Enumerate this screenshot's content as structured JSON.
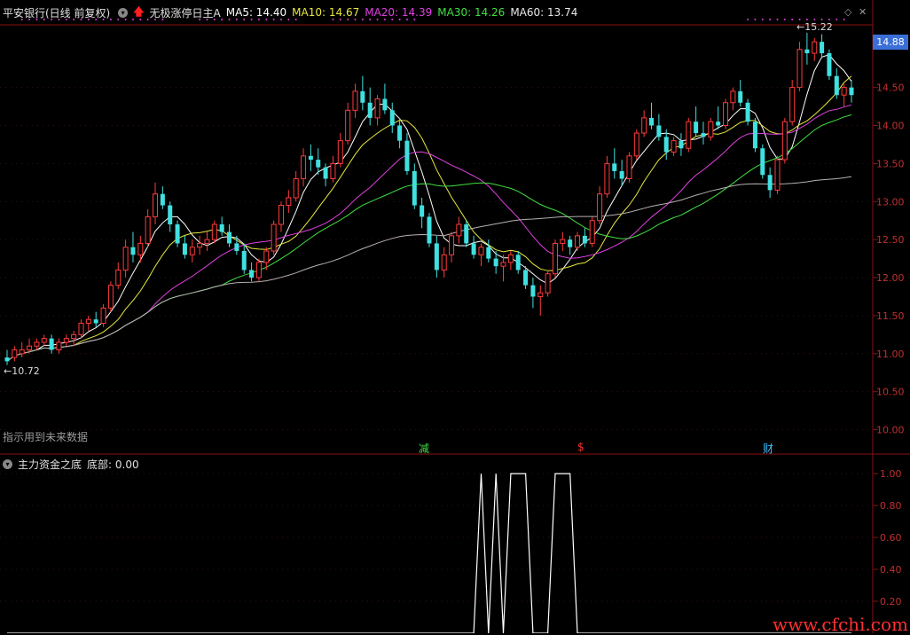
{
  "header": {
    "stock_title": "平安银行(日线 前复权)",
    "indicator_name": "无极涨停日主A",
    "ma5": {
      "label": "MA5: 14.40",
      "color": "#ffffff"
    },
    "ma10": {
      "label": "MA10: 14.67",
      "color": "#e8e840"
    },
    "ma20": {
      "label": "MA20: 14.39",
      "color": "#e040e0"
    },
    "ma30": {
      "label": "MA30: 14.26",
      "color": "#40e040"
    },
    "ma60": {
      "label": "MA60: 13.74",
      "color": "#e8e8e8"
    }
  },
  "price_axis": {
    "ticks": [
      "14.50",
      "14.00",
      "13.50",
      "13.00",
      "12.50",
      "12.00",
      "11.50",
      "11.00",
      "10.50",
      "10.00"
    ],
    "min": 9.75,
    "max": 15.3
  },
  "current_price": "14.88",
  "high_label": "15.22",
  "low_label": "10.72",
  "warning_text": "指示用到未来数据",
  "markers": [
    {
      "text": "减",
      "color": "#40e040"
    },
    {
      "text": "$",
      "color": "#ff3030"
    },
    {
      "text": "财",
      "color": "#40c0ff"
    }
  ],
  "sub_header": {
    "indicator_name": "主力资金之底",
    "value_label": "底部: 0.00"
  },
  "sub_axis": {
    "ticks": [
      "1.00",
      "0.80",
      "0.60",
      "0.40",
      "0.20"
    ]
  },
  "watermark": "www.cfchi.com",
  "chart_data": {
    "type": "candlestick",
    "candles": [
      [
        10.95,
        11.05,
        10.85,
        10.9
      ],
      [
        10.95,
        11.1,
        10.9,
        11.05
      ],
      [
        11.0,
        11.15,
        10.95,
        11.05
      ],
      [
        11.05,
        11.2,
        11.0,
        11.1
      ],
      [
        11.1,
        11.2,
        11.05,
        11.15
      ],
      [
        11.15,
        11.25,
        11.1,
        11.2
      ],
      [
        11.2,
        11.25,
        11.0,
        11.05
      ],
      [
        11.05,
        11.2,
        11.0,
        11.15
      ],
      [
        11.15,
        11.25,
        11.1,
        11.2
      ],
      [
        11.2,
        11.3,
        11.1,
        11.25
      ],
      [
        11.25,
        11.45,
        11.2,
        11.4
      ],
      [
        11.4,
        11.5,
        11.3,
        11.45
      ],
      [
        11.45,
        11.55,
        11.35,
        11.4
      ],
      [
        11.4,
        11.65,
        11.35,
        11.6
      ],
      [
        11.6,
        11.95,
        11.55,
        11.9
      ],
      [
        11.9,
        12.2,
        11.85,
        12.1
      ],
      [
        12.1,
        12.5,
        12.0,
        12.4
      ],
      [
        12.4,
        12.6,
        12.2,
        12.3
      ],
      [
        12.3,
        12.55,
        12.2,
        12.45
      ],
      [
        12.45,
        12.9,
        12.4,
        12.8
      ],
      [
        12.8,
        13.25,
        12.7,
        13.1
      ],
      [
        13.1,
        13.2,
        12.9,
        12.95
      ],
      [
        12.95,
        13.0,
        12.6,
        12.7
      ],
      [
        12.7,
        12.75,
        12.4,
        12.45
      ],
      [
        12.45,
        12.55,
        12.25,
        12.3
      ],
      [
        12.3,
        12.5,
        12.2,
        12.4
      ],
      [
        12.4,
        12.55,
        12.3,
        12.45
      ],
      [
        12.45,
        12.6,
        12.35,
        12.5
      ],
      [
        12.5,
        12.75,
        12.45,
        12.7
      ],
      [
        12.7,
        12.8,
        12.55,
        12.6
      ],
      [
        12.6,
        12.7,
        12.4,
        12.45
      ],
      [
        12.45,
        12.55,
        12.3,
        12.35
      ],
      [
        12.35,
        12.45,
        12.05,
        12.1
      ],
      [
        12.1,
        12.2,
        11.95,
        12.0
      ],
      [
        12.0,
        12.25,
        11.95,
        12.2
      ],
      [
        12.2,
        12.4,
        12.1,
        12.35
      ],
      [
        12.35,
        12.75,
        12.3,
        12.7
      ],
      [
        12.7,
        13.0,
        12.6,
        12.95
      ],
      [
        12.95,
        13.15,
        12.85,
        13.05
      ],
      [
        13.05,
        13.4,
        13.0,
        13.3
      ],
      [
        13.3,
        13.7,
        13.2,
        13.6
      ],
      [
        13.6,
        13.75,
        13.4,
        13.55
      ],
      [
        13.55,
        13.7,
        13.35,
        13.45
      ],
      [
        13.45,
        13.5,
        13.2,
        13.3
      ],
      [
        13.3,
        13.6,
        13.25,
        13.5
      ],
      [
        13.5,
        13.9,
        13.45,
        13.8
      ],
      [
        13.8,
        14.3,
        13.75,
        14.2
      ],
      [
        14.2,
        14.55,
        14.1,
        14.45
      ],
      [
        14.45,
        14.65,
        14.2,
        14.3
      ],
      [
        14.3,
        14.5,
        14.0,
        14.1
      ],
      [
        14.1,
        14.4,
        14.0,
        14.35
      ],
      [
        14.35,
        14.55,
        14.15,
        14.2
      ],
      [
        14.2,
        14.3,
        13.9,
        14.0
      ],
      [
        14.0,
        14.1,
        13.7,
        13.8
      ],
      [
        13.8,
        13.9,
        13.35,
        13.4
      ],
      [
        13.4,
        13.5,
        12.9,
        12.95
      ],
      [
        12.95,
        13.05,
        12.65,
        12.8
      ],
      [
        12.8,
        12.85,
        12.4,
        12.45
      ],
      [
        12.45,
        12.55,
        12.0,
        12.1
      ],
      [
        12.1,
        12.4,
        12.0,
        12.3
      ],
      [
        12.3,
        12.6,
        12.2,
        12.55
      ],
      [
        12.55,
        12.8,
        12.45,
        12.7
      ],
      [
        12.7,
        12.75,
        12.4,
        12.45
      ],
      [
        12.45,
        12.55,
        12.25,
        12.3
      ],
      [
        12.3,
        12.45,
        12.15,
        12.4
      ],
      [
        12.4,
        12.5,
        12.2,
        12.25
      ],
      [
        12.25,
        12.35,
        12.05,
        12.15
      ],
      [
        12.15,
        12.3,
        11.95,
        12.2
      ],
      [
        12.2,
        12.35,
        12.1,
        12.3
      ],
      [
        12.3,
        12.35,
        12.05,
        12.1
      ],
      [
        12.1,
        12.15,
        11.85,
        11.9
      ],
      [
        11.9,
        12.0,
        11.6,
        11.75
      ],
      [
        11.75,
        11.9,
        11.5,
        11.8
      ],
      [
        11.8,
        12.1,
        11.75,
        12.05
      ],
      [
        12.05,
        12.5,
        12.0,
        12.45
      ],
      [
        12.45,
        12.6,
        12.35,
        12.5
      ],
      [
        12.5,
        12.55,
        12.3,
        12.4
      ],
      [
        12.4,
        12.6,
        12.35,
        12.55
      ],
      [
        12.55,
        12.65,
        12.4,
        12.45
      ],
      [
        12.45,
        12.8,
        12.4,
        12.75
      ],
      [
        12.75,
        13.2,
        12.7,
        13.1
      ],
      [
        13.1,
        13.6,
        13.05,
        13.5
      ],
      [
        13.5,
        13.7,
        13.3,
        13.4
      ],
      [
        13.4,
        13.55,
        13.2,
        13.3
      ],
      [
        13.3,
        13.65,
        13.25,
        13.6
      ],
      [
        13.6,
        13.95,
        13.55,
        13.9
      ],
      [
        13.9,
        14.2,
        13.85,
        14.1
      ],
      [
        14.1,
        14.3,
        13.95,
        14.0
      ],
      [
        14.0,
        14.15,
        13.8,
        13.85
      ],
      [
        13.85,
        13.95,
        13.55,
        13.65
      ],
      [
        13.65,
        13.85,
        13.6,
        13.8
      ],
      [
        13.8,
        13.9,
        13.6,
        13.7
      ],
      [
        13.7,
        14.1,
        13.65,
        14.05
      ],
      [
        14.05,
        14.25,
        13.85,
        13.9
      ],
      [
        13.9,
        14.05,
        13.75,
        13.85
      ],
      [
        13.85,
        14.1,
        13.8,
        14.05
      ],
      [
        14.05,
        14.25,
        13.95,
        14.0
      ],
      [
        14.0,
        14.35,
        13.95,
        14.3
      ],
      [
        14.3,
        14.5,
        14.2,
        14.45
      ],
      [
        14.45,
        14.6,
        14.25,
        14.3
      ],
      [
        14.3,
        14.35,
        14.0,
        14.05
      ],
      [
        14.05,
        14.1,
        13.65,
        13.7
      ],
      [
        13.7,
        13.75,
        13.3,
        13.35
      ],
      [
        13.35,
        13.45,
        13.05,
        13.15
      ],
      [
        13.15,
        13.6,
        13.1,
        13.55
      ],
      [
        13.55,
        14.1,
        13.5,
        14.05
      ],
      [
        14.05,
        14.6,
        14.0,
        14.5
      ],
      [
        14.5,
        15.1,
        14.45,
        15.0
      ],
      [
        15.0,
        15.22,
        14.8,
        14.95
      ],
      [
        14.95,
        15.15,
        14.85,
        15.1
      ],
      [
        15.1,
        15.2,
        14.9,
        14.95
      ],
      [
        14.95,
        15.0,
        14.6,
        14.65
      ],
      [
        14.65,
        14.75,
        14.35,
        14.4
      ],
      [
        14.4,
        14.55,
        14.25,
        14.5
      ],
      [
        14.5,
        14.6,
        14.3,
        14.4
      ]
    ],
    "sub_series": [
      0,
      0,
      0,
      0,
      0,
      0,
      0,
      0,
      0,
      0,
      0,
      0,
      0,
      0,
      0,
      0,
      0,
      0,
      0,
      0,
      0,
      0,
      0,
      0,
      0,
      0,
      0,
      0,
      0,
      0,
      0,
      0,
      0,
      0,
      0,
      0,
      0,
      0,
      0,
      0,
      0,
      0,
      0,
      0,
      0,
      0,
      0,
      0,
      0,
      0,
      0,
      0,
      0,
      0,
      0,
      0,
      0,
      0,
      0,
      0,
      0,
      0,
      0,
      0,
      1,
      0,
      1,
      0,
      1,
      1,
      1,
      0,
      0,
      0,
      1,
      1,
      1,
      0,
      0,
      0,
      0,
      0,
      0,
      0,
      0,
      0,
      0,
      0,
      0,
      0,
      0,
      0,
      0,
      0,
      0,
      0,
      0,
      0,
      0,
      0,
      0,
      0,
      0,
      0,
      0,
      0,
      0,
      0,
      0,
      0,
      0,
      0,
      0,
      0,
      0
    ]
  }
}
